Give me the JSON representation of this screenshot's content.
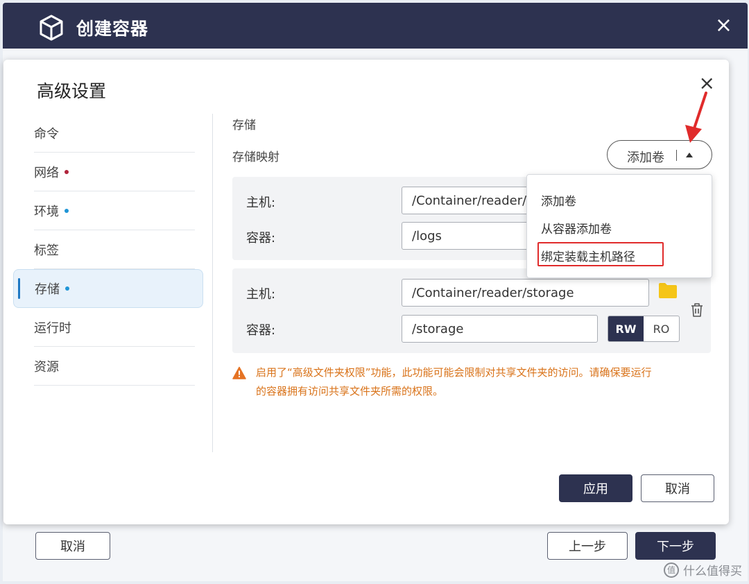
{
  "window": {
    "title": "创建容器",
    "close_icon": "×",
    "footer": {
      "cancel_label": "取消",
      "prev_label": "上一步",
      "next_label": "下一步"
    }
  },
  "modal": {
    "title": "高级设置",
    "close_icon": "×",
    "nav": [
      {
        "label": "命令",
        "dot": null
      },
      {
        "label": "网络",
        "dot": "#b0243b"
      },
      {
        "label": "环境",
        "dot": "#1f95d6"
      },
      {
        "label": "标签",
        "dot": null
      },
      {
        "label": "存储",
        "dot": "#1f95d6",
        "active": true
      },
      {
        "label": "运行时",
        "dot": null
      },
      {
        "label": "资源",
        "dot": null
      }
    ],
    "storage": {
      "section_title": "存储",
      "mapping_title": "存储映射",
      "add_volume_label": "添加卷",
      "mappings": [
        {
          "host_label": "主机:",
          "host_value": "/Container/reader/logs",
          "container_label": "容器:",
          "container_value": "/logs"
        },
        {
          "host_label": "主机:",
          "host_value": "/Container/reader/storage",
          "container_label": "容器:",
          "container_value": "/storage",
          "mode_rw": "RW",
          "mode_ro": "RO",
          "selected_mode": "RW"
        }
      ],
      "warning_line1": "启用了“高级文件夹权限”功能，此功能可能会限制对共享文件夹的访问。请确保要运行",
      "warning_line2": "的容器拥有访问共享文件夹所需的权限。"
    },
    "apply_label": "应用",
    "cancel_label": "取消"
  },
  "dropdown": {
    "items": [
      "添加卷",
      "从容器添加卷",
      "绑定装载主机路径"
    ],
    "highlighted_index": 2
  },
  "colors": {
    "header_dark": "#2d3250",
    "accent_blue": "#1f79c4",
    "warning_orange": "#d9731a",
    "folder_yellow": "#f5c518",
    "annotation_red": "#e02b2b"
  },
  "watermark": {
    "glyph": "值",
    "text": "什么值得买"
  }
}
